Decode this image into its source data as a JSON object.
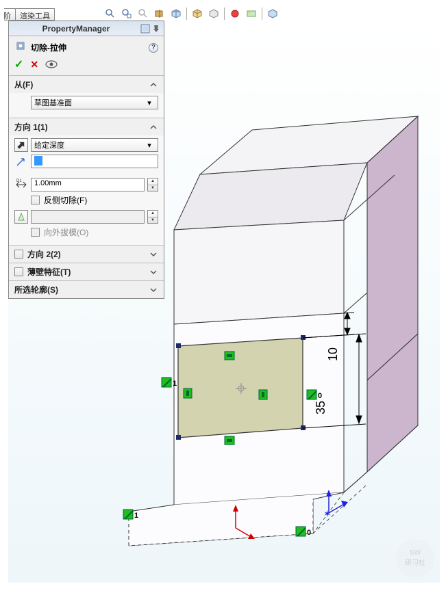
{
  "tabs": {
    "t1": "阶",
    "t2": "渲染工具"
  },
  "pm": {
    "title": "PropertyManager",
    "feature_name": "切除-拉伸",
    "from": {
      "title": "从(F)",
      "value": "草图基准面"
    },
    "dir1": {
      "title": "方向 1(1)",
      "end_condition": "给定深度",
      "depth_value": "1.00mm",
      "flip_label": "反侧切除(F)",
      "draft_label": "向外拔模(O)"
    },
    "dir2": {
      "title": "方向 2(2)"
    },
    "thin": {
      "title": "薄壁特征(T)"
    },
    "contours": {
      "title": "所选轮廓(S)"
    }
  },
  "dims": {
    "d1": "10",
    "d2": "35"
  },
  "rel": {
    "z1": "1",
    "z0": "0"
  },
  "watermark": {
    "l1": "SW",
    "l2": "研习社"
  }
}
